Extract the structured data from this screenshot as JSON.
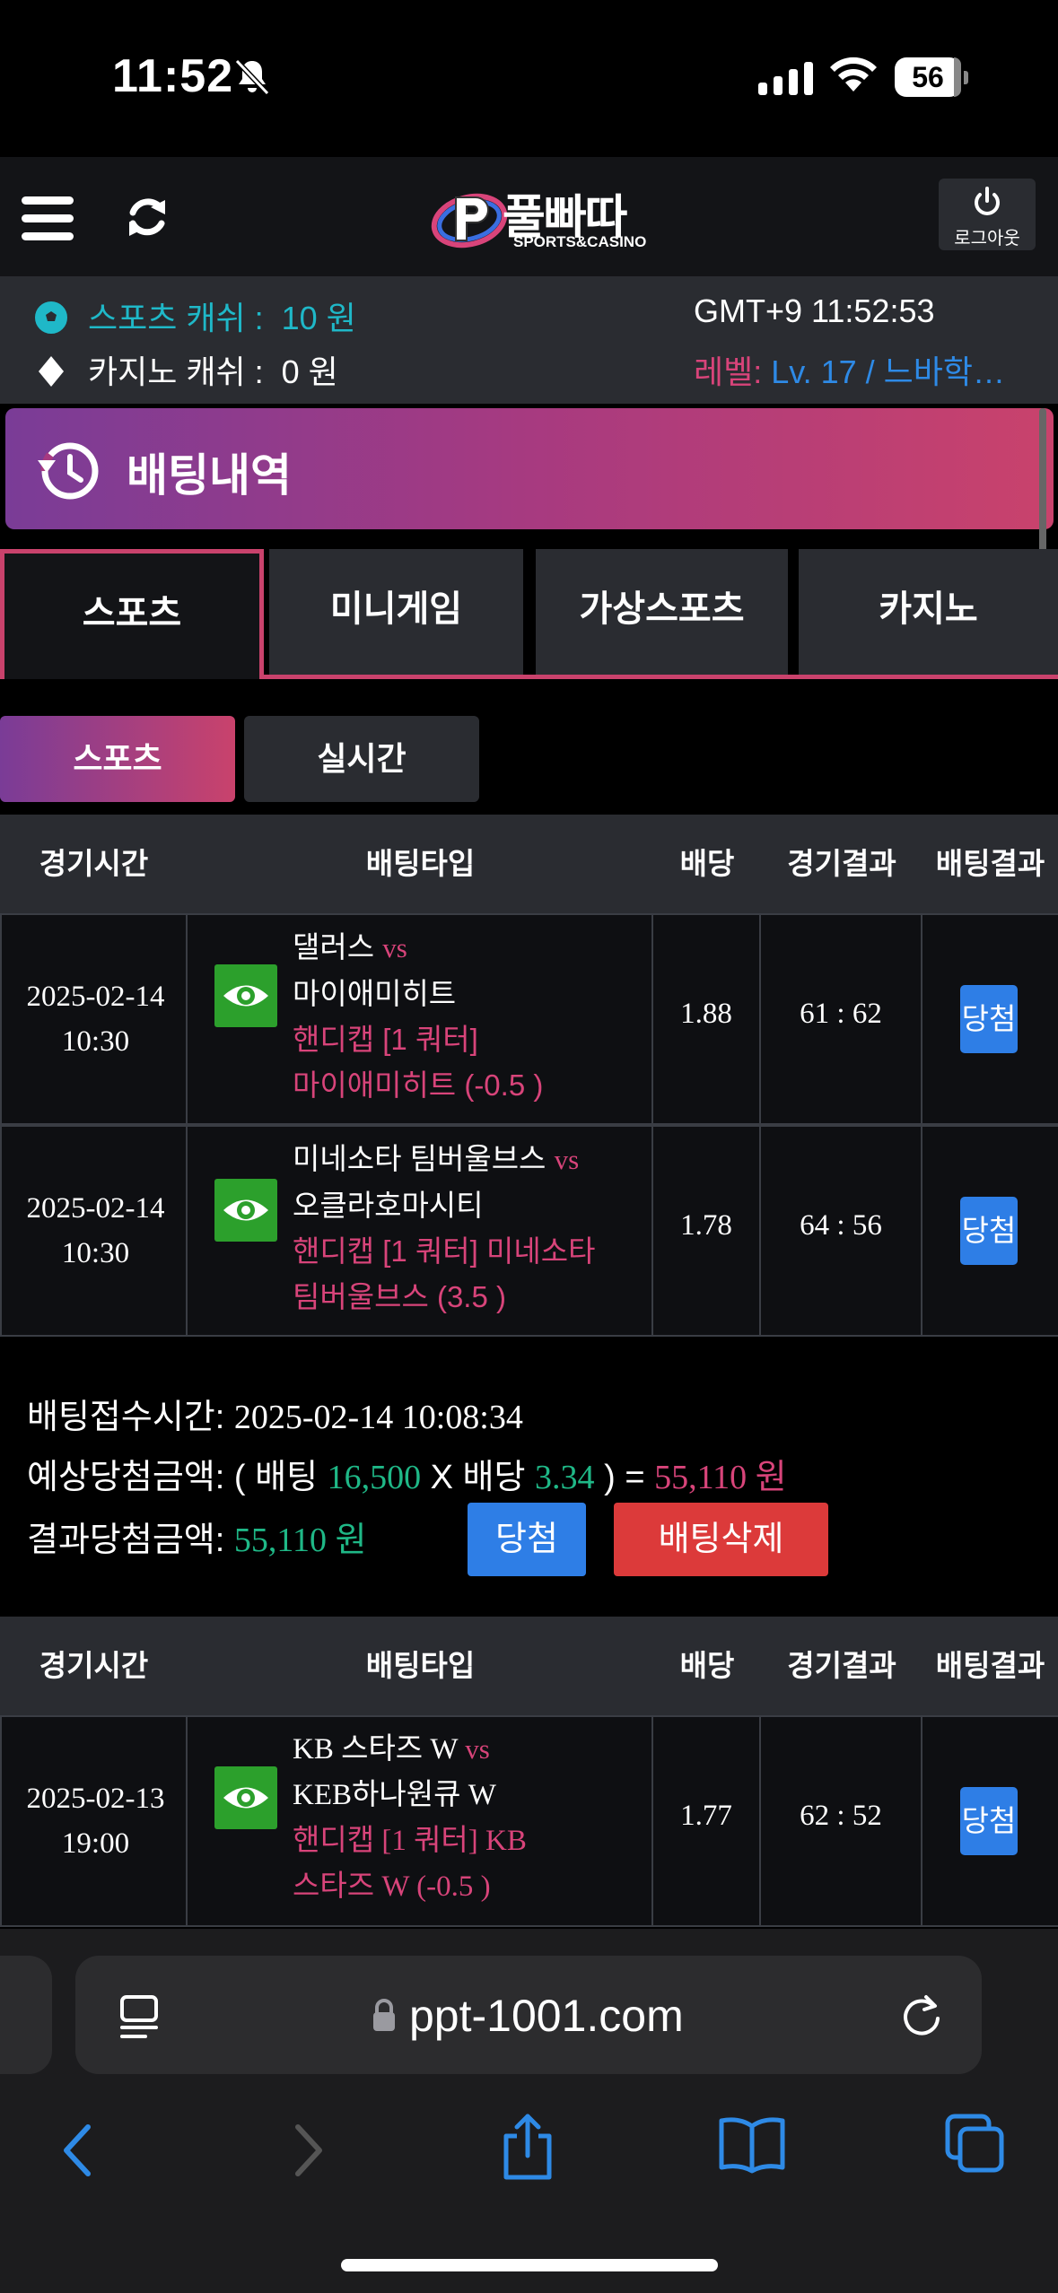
{
  "status_bar": {
    "time": "11:52",
    "battery": "56"
  },
  "header": {
    "logo_title": "풀빠따",
    "logo_subtitle": "SPORTS&CASINO",
    "logout_label": "로그아웃"
  },
  "info": {
    "sports_cash_label": "스포츠 캐쉬 :",
    "sports_cash_value": "10 원",
    "casino_cash_label": "카지노 캐쉬 :",
    "casino_cash_value": "0 원",
    "clock": "GMT+9 11:52:53",
    "level_prefix": "레벨: ",
    "level_value": "Lv. 17 / 느바학…"
  },
  "page_title": "배팅내역",
  "tabs": [
    "스포츠",
    "미니게임",
    "가상스포츠",
    "카지노"
  ],
  "subtabs": [
    "스포츠",
    "실시간"
  ],
  "table_headers": [
    "경기시간",
    "배팅타입",
    "배당",
    "경기결과",
    "배팅결과"
  ],
  "slip1": {
    "rows": [
      {
        "date": "2025-02-14",
        "time": "10:30",
        "home": "댈러스",
        "vs": "vs",
        "away": "마이애미히트",
        "hc_line1": "핸디캡 [1 쿼터]",
        "hc_line2": "마이애미히트 (-0.5 )",
        "odds": "1.88",
        "score": "61 : 62",
        "result": "당첨"
      },
      {
        "date": "2025-02-14",
        "time": "10:30",
        "home": "미네소타 팀버울브스",
        "vs": "vs",
        "away": "오클라호마시티",
        "hc_line1": "핸디캡 [1 쿼터] 미네소타",
        "hc_line2": "팀버울브스 (3.5 )",
        "odds": "1.78",
        "score": "64 : 56",
        "result": "당첨"
      }
    ],
    "accept_label": "배팅접수시간:",
    "accept_time": "2025-02-14 10:08:34",
    "expected_label": "예상당첨금액:",
    "expected_open": "( 배팅",
    "stake": "16,500",
    "expected_x": "X 배당",
    "total_odds": "3.34",
    "expected_eq": ") =",
    "expected_amount": "55,110 원",
    "result_label": "결과당첨금액:",
    "result_amount": "55,110 원",
    "win_button": "당첨",
    "delete_button": "배팅삭제"
  },
  "slip2": {
    "rows": [
      {
        "date": "2025-02-13",
        "time": "19:00",
        "home": "KB 스타즈 W",
        "vs": "vs",
        "away": "KEB하나원큐 W",
        "hc_line1": "핸디캡 [1 쿼터] KB",
        "hc_line2": "스타즈 W (-0.5 )",
        "odds": "1.77",
        "score": "62 : 52",
        "result": "당첨"
      }
    ]
  },
  "browser": {
    "url": "ppt-1001.com"
  },
  "colors": {
    "accent_pink": "#c9426c",
    "accent_purple": "#7a3c97",
    "win_blue": "#2e7ee6",
    "delete_red": "#dc3a3a",
    "cash_cyan": "#1fb8c8",
    "money_green": "#1fb887"
  }
}
